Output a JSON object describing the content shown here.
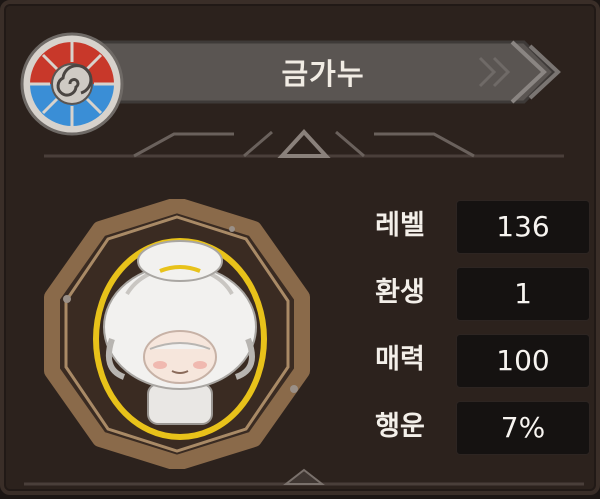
{
  "character": {
    "name": "금가누",
    "class_icon": "swirl-emblem-icon",
    "portrait": "white-haired-character-portrait"
  },
  "stats": [
    {
      "label": "레벨",
      "value": "136"
    },
    {
      "label": "환생",
      "value": "1"
    },
    {
      "label": "매력",
      "value": "100"
    },
    {
      "label": "행운",
      "value": "7%"
    }
  ],
  "colors": {
    "panel": "#2c221d",
    "title_bar": "#5a5552",
    "value_box": "#151211",
    "frame_wood": "#8a6a4a",
    "portrait_glow": "#e8c21a",
    "emblem_red": "#c8382a",
    "emblem_blue": "#3a8ed6"
  }
}
